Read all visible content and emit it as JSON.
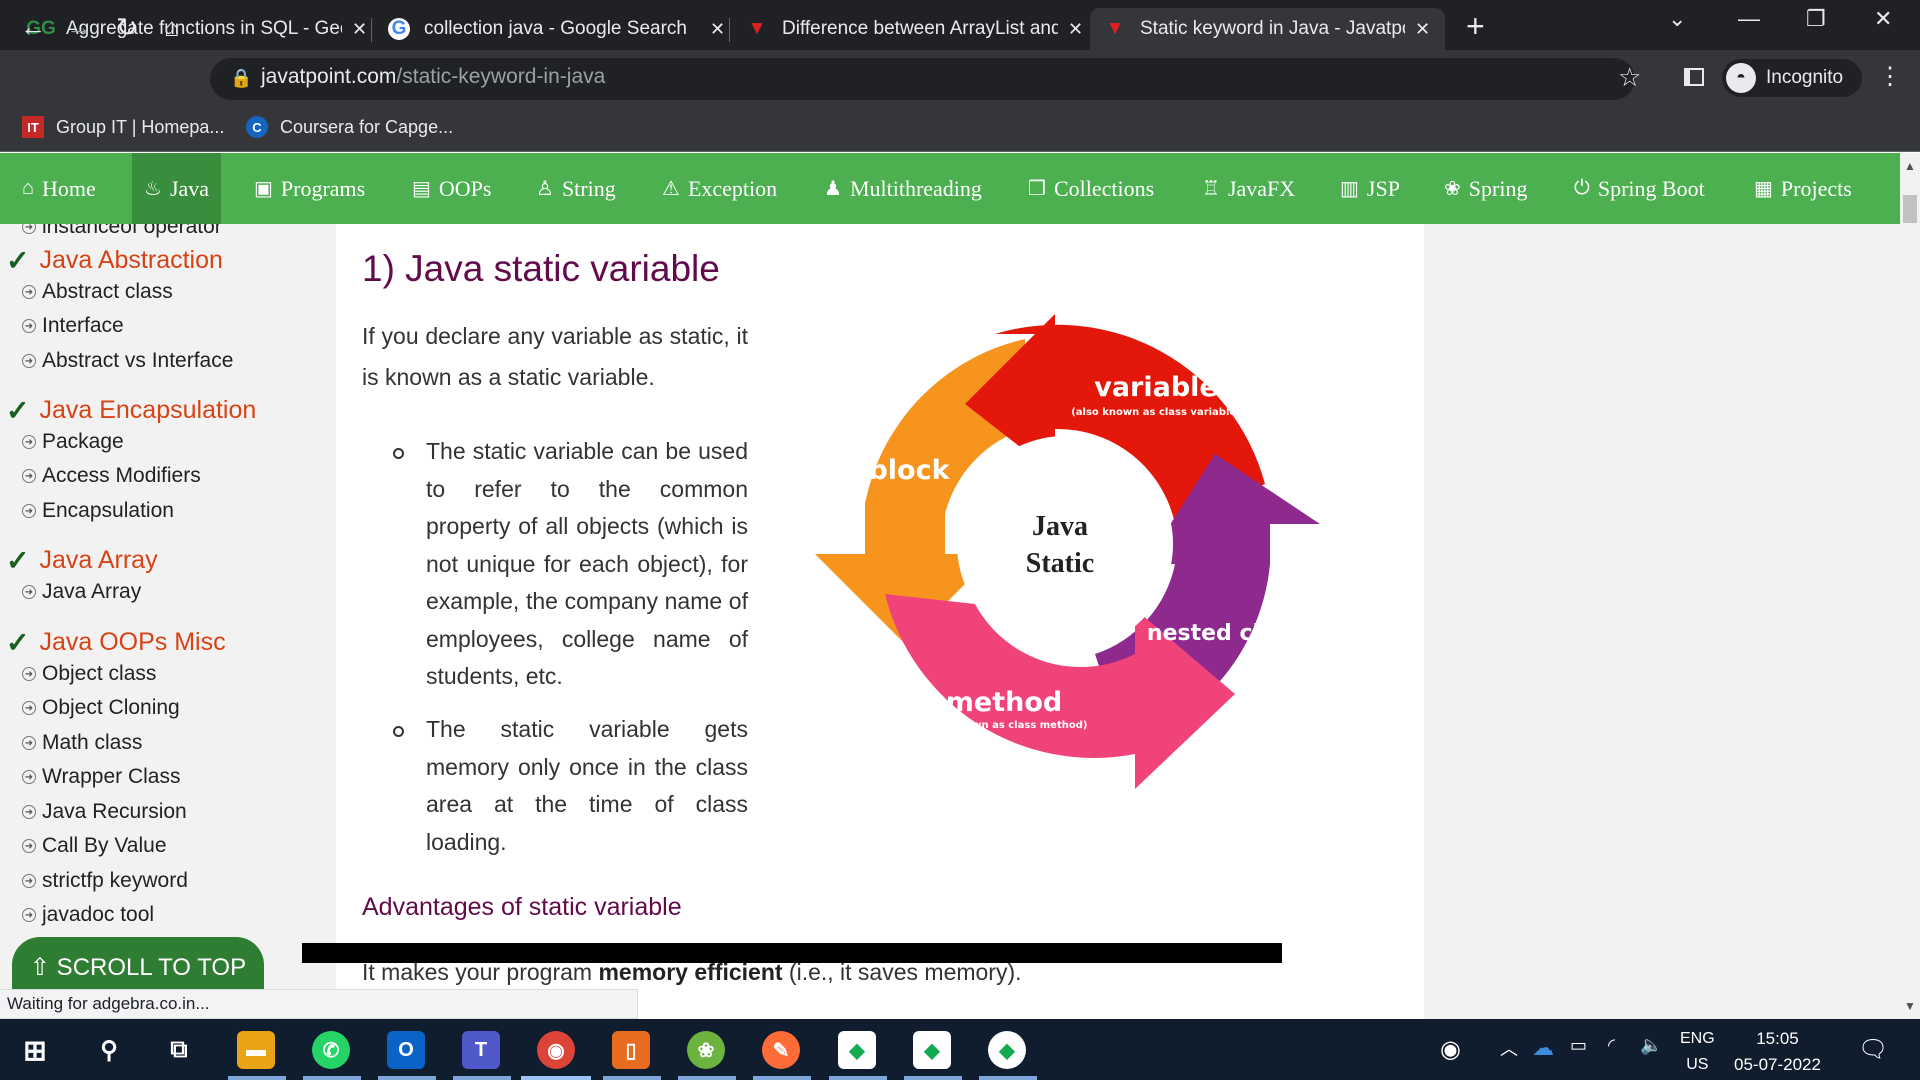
{
  "tabs": [
    {
      "title": "Aggregate functions in SQL - GeeksforGeeks",
      "favicon": "geeksforgeeks-icon",
      "color": "#2f8d46"
    },
    {
      "title": "collection java - Google Search",
      "favicon": "google-icon",
      "color": "#4285f4"
    },
    {
      "title": "Difference between ArrayList and",
      "favicon": "javatpoint-icon",
      "color": "#e02020"
    },
    {
      "title": "Static keyword in Java - Javatpoint",
      "favicon": "javatpoint-icon",
      "color": "#e02020"
    }
  ],
  "toolbar": {
    "url_domain": "javatpoint.com",
    "url_path": "/static-keyword-in-java",
    "incognito_label": "Incognito"
  },
  "bookmarks": [
    {
      "label": "Group IT | Homepa...",
      "icon": "it-icon",
      "color": "#c62828",
      "icon_text": "IT"
    },
    {
      "label": "Coursera for Capge...",
      "icon": "coursera-icon",
      "color": "#1565c0",
      "icon_text": "C"
    }
  ],
  "nav": [
    {
      "label": "Home",
      "icon": "home-icon",
      "glyph": "⌂"
    },
    {
      "label": "Java",
      "icon": "java-icon",
      "glyph": "♨"
    },
    {
      "label": "Programs",
      "icon": "programs-icon",
      "glyph": "▣"
    },
    {
      "label": "OOPs",
      "icon": "oops-icon",
      "glyph": "▤"
    },
    {
      "label": "String",
      "icon": "string-icon",
      "glyph": "♙"
    },
    {
      "label": "Exception",
      "icon": "exception-icon",
      "glyph": "⚠"
    },
    {
      "label": "Multithreading",
      "icon": "multithreading-icon",
      "glyph": "♟"
    },
    {
      "label": "Collections",
      "icon": "collections-icon",
      "glyph": "❐"
    },
    {
      "label": "JavaFX",
      "icon": "javafx-icon",
      "glyph": "♖"
    },
    {
      "label": "JSP",
      "icon": "jsp-icon",
      "glyph": "▥"
    },
    {
      "label": "Spring",
      "icon": "spring-icon",
      "glyph": "❀"
    },
    {
      "label": "Spring Boot",
      "icon": "spring-boot-icon",
      "glyph": "⏻"
    },
    {
      "label": "Projects",
      "icon": "projects-icon",
      "glyph": "▦"
    }
  ],
  "sidebar": {
    "partial_item": "instanceof operator",
    "groups": [
      {
        "heading": "Java Abstraction",
        "items": [
          "Abstract class",
          "Interface",
          "Abstract vs Interface"
        ]
      },
      {
        "heading": "Java Encapsulation",
        "items": [
          "Package",
          "Access Modifiers",
          "Encapsulation"
        ]
      },
      {
        "heading": "Java Array",
        "items": [
          "Java Array"
        ]
      },
      {
        "heading": "Java OOPs Misc",
        "items": [
          "Object class",
          "Object Cloning",
          "Math class",
          "Wrapper Class",
          "Java Recursion",
          "Call By Value",
          "strictfp keyword",
          "javadoc tool"
        ]
      }
    ],
    "scroll_top_label": "⇧ SCROLL TO TOP"
  },
  "content": {
    "heading": "1) Java static variable",
    "intro": "If you declare any variable as static, it is known as a static variable.",
    "bullets": [
      "The static variable can be used to refer to the common property of all objects (which is not unique for each object), for example, the company name of employees, college name of students, etc.",
      "The static variable gets memory only once in the class area at the time of class loading."
    ],
    "subheading": "Advantages of static variable",
    "advantage_prefix": "It makes your program ",
    "advantage_bold": "memory efficient",
    "advantage_suffix": " (i.e., it saves memory)."
  },
  "diagram": {
    "center_line1": "Java",
    "center_line2": "Static",
    "variable_label": "variable",
    "variable_sub": "(also known as class variable)",
    "block_label": "block",
    "nested_label": "nested class",
    "method_label": "method",
    "method_sub": "(also known as class method)",
    "colors": {
      "variable": "#e3170a",
      "nested": "#8e2a8e",
      "method": "#f0437a",
      "block": "#f7941d"
    }
  },
  "status_text": "Waiting for adgebra.co.in...",
  "taskbar": {
    "apps": [
      {
        "name": "file-explorer-icon",
        "glyph": "▬",
        "bg": "#e8a317"
      },
      {
        "name": "whatsapp-icon",
        "glyph": "✆",
        "bg": "#25d366"
      },
      {
        "name": "outlook-icon",
        "glyph": "O",
        "bg": "#0a64c8"
      },
      {
        "name": "teams-icon",
        "glyph": "T",
        "bg": "#5059c9"
      },
      {
        "name": "chrome-icon",
        "glyph": "◉",
        "bg": "#db4437"
      },
      {
        "name": "powerpoint-icon",
        "glyph": "▯",
        "bg": "#e86c1f"
      },
      {
        "name": "spring-tool-suite-icon",
        "glyph": "❀",
        "bg": "#6db33f"
      },
      {
        "name": "postman-icon",
        "glyph": "✎",
        "bg": "#ff6c37"
      },
      {
        "name": "mongodb-compass-icon-1",
        "glyph": "◆",
        "bg": "#13aa52"
      },
      {
        "name": "mongodb-compass-icon-2",
        "glyph": "◆",
        "bg": "#13aa52"
      },
      {
        "name": "mongodb-compass-icon-3",
        "glyph": "◆",
        "bg": "#13aa52"
      }
    ],
    "lang_line1": "ENG",
    "lang_line2": "US",
    "time": "15:05",
    "date": "05-07-2022"
  }
}
